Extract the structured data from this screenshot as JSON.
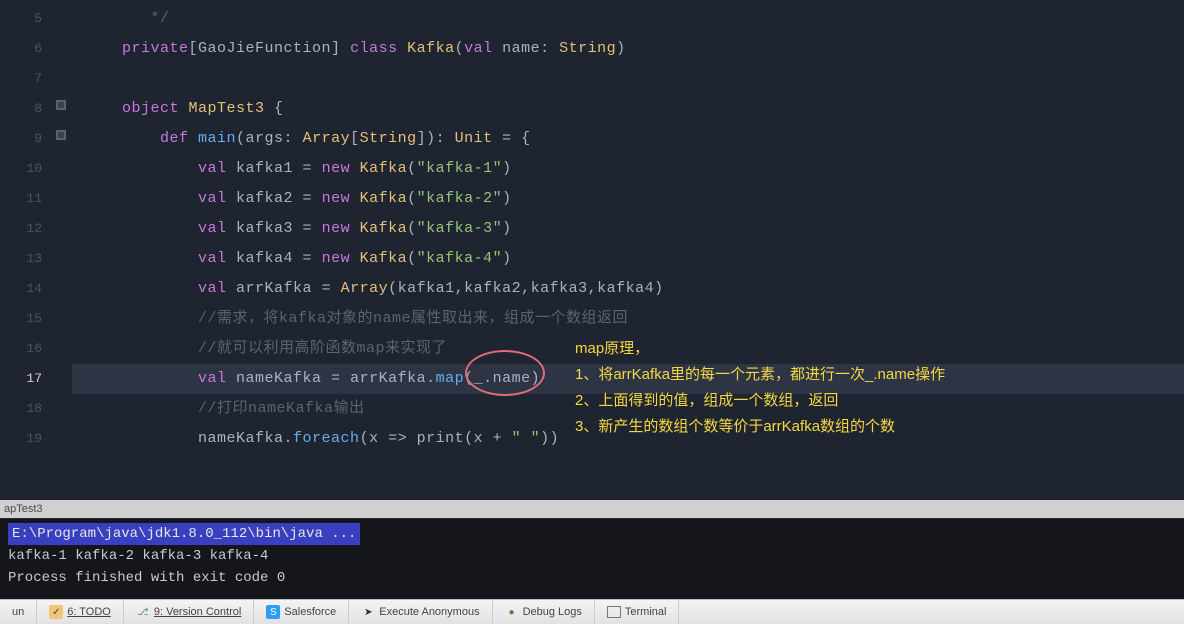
{
  "code": {
    "lines": [
      {
        "no": 5,
        "hl": false,
        "tokens": [
          [
            "sp",
            "       "
          ],
          [
            "cmt",
            "*/"
          ]
        ]
      },
      {
        "no": 6,
        "hl": false,
        "tokens": [
          [
            "sp",
            "    "
          ],
          [
            "kw",
            "private"
          ],
          [
            "ident",
            "[GaoJieFunction] "
          ],
          [
            "kw",
            "class "
          ],
          [
            "type",
            "Kafka"
          ],
          [
            "ident",
            "("
          ],
          [
            "kw",
            "val "
          ],
          [
            "ident",
            "name: "
          ],
          [
            "type",
            "String"
          ],
          [
            "ident",
            ")"
          ]
        ]
      },
      {
        "no": 7,
        "hl": false,
        "tokens": []
      },
      {
        "no": 8,
        "hl": false,
        "tokens": [
          [
            "sp",
            "    "
          ],
          [
            "kw",
            "object "
          ],
          [
            "type",
            "MapTest3"
          ],
          [
            "ident",
            " {"
          ]
        ]
      },
      {
        "no": 9,
        "hl": false,
        "tokens": [
          [
            "sp",
            "        "
          ],
          [
            "kw",
            "def "
          ],
          [
            "fn",
            "main"
          ],
          [
            "ident",
            "(args: "
          ],
          [
            "type",
            "Array"
          ],
          [
            "ident",
            "["
          ],
          [
            "type",
            "String"
          ],
          [
            "ident",
            "]): "
          ],
          [
            "type",
            "Unit"
          ],
          [
            "ident",
            " = {"
          ]
        ]
      },
      {
        "no": 10,
        "hl": false,
        "tokens": [
          [
            "sp",
            "            "
          ],
          [
            "kw",
            "val "
          ],
          [
            "ident",
            "kafka1 = "
          ],
          [
            "kw",
            "new "
          ],
          [
            "type",
            "Kafka"
          ],
          [
            "ident",
            "("
          ],
          [
            "str",
            "\"kafka-1\""
          ],
          [
            "ident",
            ")"
          ]
        ]
      },
      {
        "no": 11,
        "hl": false,
        "tokens": [
          [
            "sp",
            "            "
          ],
          [
            "kw",
            "val "
          ],
          [
            "ident",
            "kafka2 = "
          ],
          [
            "kw",
            "new "
          ],
          [
            "type",
            "Kafka"
          ],
          [
            "ident",
            "("
          ],
          [
            "str",
            "\"kafka-2\""
          ],
          [
            "ident",
            ")"
          ]
        ]
      },
      {
        "no": 12,
        "hl": false,
        "tokens": [
          [
            "sp",
            "            "
          ],
          [
            "kw",
            "val "
          ],
          [
            "ident",
            "kafka3 = "
          ],
          [
            "kw",
            "new "
          ],
          [
            "type",
            "Kafka"
          ],
          [
            "ident",
            "("
          ],
          [
            "str",
            "\"kafka-3\""
          ],
          [
            "ident",
            ")"
          ]
        ]
      },
      {
        "no": 13,
        "hl": false,
        "tokens": [
          [
            "sp",
            "            "
          ],
          [
            "kw",
            "val "
          ],
          [
            "ident",
            "kafka4 = "
          ],
          [
            "kw",
            "new "
          ],
          [
            "type",
            "Kafka"
          ],
          [
            "ident",
            "("
          ],
          [
            "str",
            "\"kafka-4\""
          ],
          [
            "ident",
            ")"
          ]
        ]
      },
      {
        "no": 14,
        "hl": false,
        "tokens": [
          [
            "sp",
            "            "
          ],
          [
            "kw",
            "val "
          ],
          [
            "ident",
            "arrKafka = "
          ],
          [
            "type",
            "Array"
          ],
          [
            "ident",
            "(kafka1,kafka2,kafka3,kafka4)"
          ]
        ]
      },
      {
        "no": 15,
        "hl": false,
        "tokens": [
          [
            "sp",
            "            "
          ],
          [
            "cmt",
            "//需求，将kafka对象的name属性取出来，组成一个数组返回"
          ]
        ]
      },
      {
        "no": 16,
        "hl": false,
        "tokens": [
          [
            "sp",
            "            "
          ],
          [
            "cmt",
            "//就可以利用高阶函数map来实现了"
          ]
        ]
      },
      {
        "no": 17,
        "hl": true,
        "tokens": [
          [
            "sp",
            "            "
          ],
          [
            "kw",
            "val "
          ],
          [
            "ident",
            "nameKafka = arrKafka."
          ],
          [
            "fn",
            "map"
          ],
          [
            "ident",
            "(_.name)"
          ]
        ]
      },
      {
        "no": 18,
        "hl": false,
        "tokens": [
          [
            "sp",
            "            "
          ],
          [
            "cmt",
            "//打印nameKafka输出"
          ]
        ]
      },
      {
        "no": 19,
        "hl": false,
        "tokens": [
          [
            "sp",
            "            "
          ],
          [
            "ident",
            "nameKafka."
          ],
          [
            "fn",
            "foreach"
          ],
          [
            "ident",
            "(x => print(x + "
          ],
          [
            "str",
            "\" \""
          ],
          [
            "ident",
            "))"
          ]
        ]
      }
    ]
  },
  "gutter_icons": {
    "8": true,
    "9": true
  },
  "annotation": {
    "title": "map原理，",
    "l1": "1、将arrKafka里的每一个元素，都进行一次_.name操作",
    "l2": "2、上面得到的值，组成一个数组，返回",
    "l3": "3、新产生的数组个数等价于arrKafka数组的个数"
  },
  "tab_label": "apTest3",
  "console": {
    "cmd": "E:\\Program\\java\\jdk1.8.0_112\\bin\\java ...",
    "out1": "kafka-1 kafka-2 kafka-3 kafka-4",
    "out2": "Process finished with exit code 0"
  },
  "bottom": {
    "run": "un",
    "todo": "6: TODO",
    "vc": "9: Version Control",
    "sf": "Salesforce",
    "exec": "Execute Anonymous",
    "debug": "Debug Logs",
    "term": "Terminal"
  }
}
